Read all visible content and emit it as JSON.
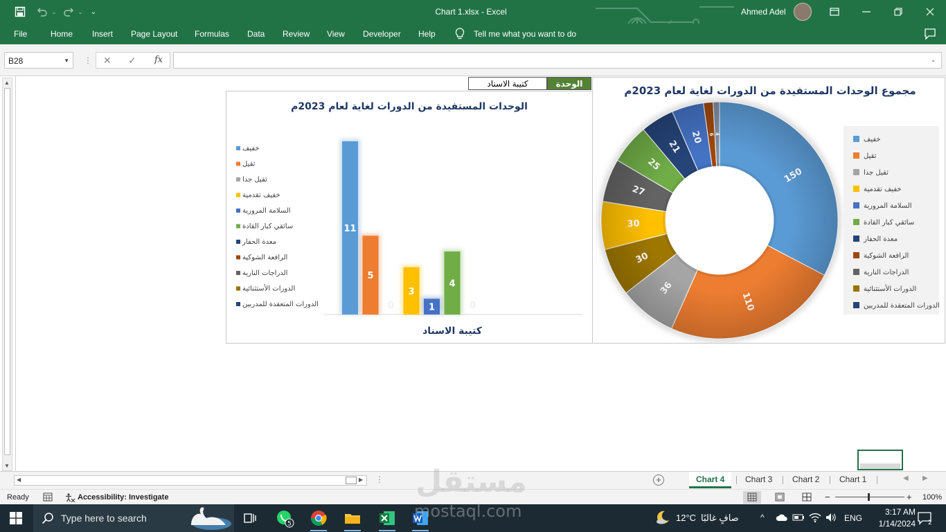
{
  "title_bar": {
    "document_title": "Chart 1.xlsx  -  Excel",
    "user_name": "Ahmed Adel",
    "quick_access": [
      "save-icon",
      "undo-icon",
      "redo-icon",
      "customize-icon"
    ],
    "accent_color": "#217346"
  },
  "ribbon": {
    "tabs": [
      "File",
      "Home",
      "Insert",
      "Page Layout",
      "Formulas",
      "Data",
      "Review",
      "View",
      "Developer",
      "Help"
    ],
    "tell_me": "Tell me what you want to do"
  },
  "formula_bar": {
    "name_box": "B28",
    "formula": ""
  },
  "sheet": {
    "header_unit": "الوحدة",
    "header_battalion": "كتيبة الاسناد"
  },
  "bar_chart": {
    "categories": [
      "خفيف",
      "ثقيل",
      "ثقيل جدا",
      "خفيف تقدمية",
      "السلامة المرورية",
      "سائقي كبار القادة",
      "معدة الحفار",
      "الرافعة الشوكية",
      "الدراجات النارية",
      "الدورات الأستثنائية",
      "الدورات المتعقدة للمدربين"
    ]
  },
  "pie_chart": {
    "legend": [
      "خفيف",
      "ثقيل",
      "ثقيل جدا",
      "خفيف تقدمية",
      "السلامة المرورية",
      "سائقي كبار القادة",
      "معدة الحفار",
      "الرافعة الشوكية",
      "الدراجات النارية",
      "الدورات الأستثنائية",
      "الدورات المتعقدة للمدربين"
    ]
  },
  "chart_data": [
    {
      "type": "bar",
      "title": "الوحدات المستفيدة من الدورات لغاية لعام 2023م",
      "xlabel": "كتيبة الاسناد",
      "categories": [
        "خفيف",
        "ثقيل",
        "ثقيل جدا",
        "خفيف تقدمية",
        "السلامة المرورية",
        "سائقي كبار القادة",
        "معدة الحفار"
      ],
      "values": [
        11,
        5,
        0,
        3,
        1,
        4,
        0
      ],
      "data_labels": [
        "11",
        "5",
        "0",
        "3",
        "1",
        "4",
        "0"
      ],
      "colors": [
        "#5b9bd5",
        "#ed7d31",
        "#a5a5a5",
        "#ffc000",
        "#4472c4",
        "#70ad47",
        "#264478"
      ],
      "legend_placement": "left",
      "ylim": [
        0,
        11
      ],
      "grid": false
    },
    {
      "type": "pie",
      "title": "مجموع الوحدات المستفيدة من الدورات لغاية لعام 2023م",
      "categories": [
        "خفيف",
        "ثقيل",
        "ثقيل جدا",
        "الدراجات النارية",
        "خفيف تقدمية",
        "الدراجات النارية",
        "سائقي كبار القادة",
        "معدة الحفار",
        "السلامة المرورية",
        "الرافعة الشوكية",
        "الدراجات النارية"
      ],
      "values": [
        150,
        110,
        36,
        30,
        30,
        27,
        25,
        21,
        20,
        6,
        4
      ],
      "data_labels": [
        "150",
        "110",
        "36",
        "30",
        "30",
        "27",
        "25",
        "21",
        "20",
        "6",
        "4"
      ],
      "colors": [
        "#5b9bd5",
        "#ed7d31",
        "#a5a5a5",
        "#9e7700",
        "#ffc000",
        "#636363",
        "#70ad47",
        "#264478",
        "#4472c4",
        "#9e480e",
        "#7f8fa6"
      ],
      "legend_placement": "right",
      "donut": true
    }
  ],
  "sheet_tabs": [
    "Chart 4",
    "Chart 3",
    "Chart 2",
    "Chart 1"
  ],
  "active_sheet": "Chart 4",
  "status_bar": {
    "ready": "Ready",
    "accessibility": "Accessibility: Investigate",
    "zoom": "100%"
  },
  "taskbar": {
    "search_placeholder": "Type here to search",
    "whatsapp_badge": "5",
    "temperature": "12°C",
    "weather": "صافٍ غالبًا",
    "language": "ENG",
    "time": "3:17 AM",
    "date": "1/14/2024",
    "notifications": "2"
  },
  "watermark": {
    "arabic": "مستقل",
    "latin": "mostaql.com"
  }
}
